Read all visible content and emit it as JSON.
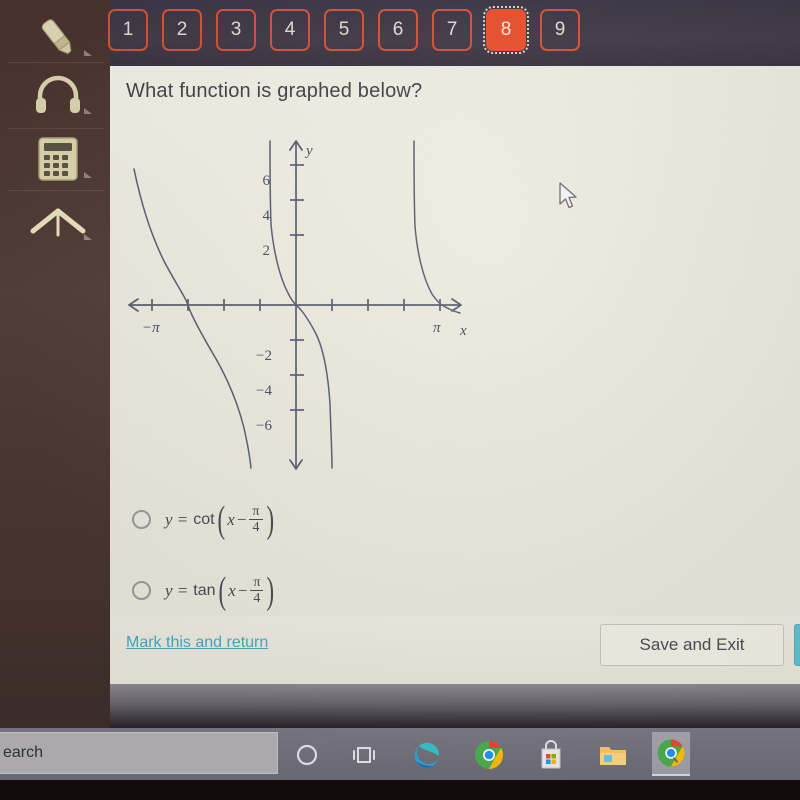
{
  "window": {
    "app": "online-assessment"
  },
  "sidebar": {
    "items": [
      {
        "name": "highlighter",
        "icon": "highlighter-icon",
        "label": "Highlighter"
      },
      {
        "name": "headphones",
        "icon": "headphones-icon",
        "label": "Read Aloud"
      },
      {
        "name": "calculator",
        "icon": "calculator-icon",
        "label": "Calculator"
      },
      {
        "name": "collapse",
        "icon": "chevron-up-icon",
        "label": "Collapse"
      }
    ]
  },
  "question_tabs": {
    "items": [
      {
        "label": "1",
        "active": false
      },
      {
        "label": "2",
        "active": false
      },
      {
        "label": "3",
        "active": false
      },
      {
        "label": "4",
        "active": false
      },
      {
        "label": "5",
        "active": false
      },
      {
        "label": "6",
        "active": false
      },
      {
        "label": "7",
        "active": false
      },
      {
        "label": "8",
        "active": true
      },
      {
        "label": "9",
        "active": false
      }
    ],
    "active_label": "8",
    "accent_color": "#e8502e",
    "outline_color": "#d8503a"
  },
  "question": {
    "prompt": "What function is graphed below?"
  },
  "chart_data": {
    "type": "line",
    "title": "",
    "xlabel": "x",
    "ylabel": "y",
    "function": "y = cot(x - pi/4)",
    "y_tick_labels": [
      "6",
      "4",
      "2",
      "-2",
      "-4",
      "-6"
    ],
    "y_tick_values": [
      6,
      4,
      2,
      -2,
      -4,
      -6
    ],
    "x_tick_labels": [
      "-π",
      "π"
    ],
    "x_labeled_values": [
      -3.14159,
      3.14159
    ],
    "x_tick_values": [
      -3.14159,
      -2.356,
      -1.5708,
      -0.7854,
      0.7854,
      1.5708,
      2.356,
      3.14159
    ],
    "xlim": [
      -4.3,
      4.6
    ],
    "ylim": [
      -7.6,
      7.4
    ],
    "grid": false,
    "legend": false,
    "asymptotes": [
      -2.356,
      0.7854,
      3.927
    ],
    "zeros": [
      -1.5708,
      1.5708
    ],
    "branches": [
      {
        "name": "left-branch",
        "x_range": [
          -4.3,
          -2.356
        ]
      },
      {
        "name": "middle-branch",
        "x_range": [
          -2.356,
          0.7854
        ]
      },
      {
        "name": "right-branch",
        "x_range": [
          0.7854,
          3.927
        ]
      }
    ]
  },
  "choices": [
    {
      "id": "choice-a",
      "selected": false,
      "lhs": "y =",
      "fn": "cot",
      "arg_var": "x",
      "arg_op": "−",
      "frac_num": "π",
      "frac_den": "4",
      "full_text": "y = cot(x − π/4)"
    },
    {
      "id": "choice-b",
      "selected": false,
      "lhs": "y =",
      "fn": "tan",
      "arg_var": "x",
      "arg_op": "−",
      "frac_num": "π",
      "frac_den": "4",
      "full_text": "y = tan(x − π/4)"
    }
  ],
  "footer": {
    "mark_link": "Mark this and return",
    "save_button": "Save and Exit",
    "link_color": "#4aa8c4",
    "next_button_color": "#62c2cf"
  },
  "taskbar": {
    "search_text": "earch",
    "search_placeholder": "Search",
    "icons": [
      {
        "name": "cortana-icon",
        "label": "Cortana"
      },
      {
        "name": "task-view-icon",
        "label": "Task View"
      },
      {
        "name": "edge-icon",
        "label": "Microsoft Edge"
      },
      {
        "name": "chrome-icon",
        "label": "Google Chrome"
      },
      {
        "name": "microsoft-store-icon",
        "label": "Microsoft Store"
      },
      {
        "name": "file-explorer-icon",
        "label": "File Explorer"
      },
      {
        "name": "chrome-window-icon",
        "label": "Chrome",
        "active": true
      }
    ]
  }
}
